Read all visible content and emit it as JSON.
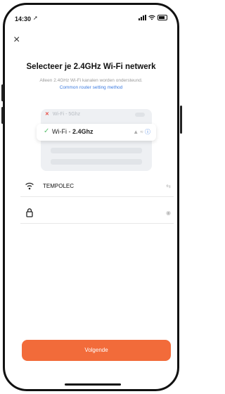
{
  "status": {
    "time": "14:30",
    "location_glyph": "➚"
  },
  "nav": {
    "close_glyph": "×"
  },
  "page": {
    "title": "Selecteer je 2.4GHz Wi-Fi netwerk",
    "subtitle": "Alleen 2.4GHz Wi-Fi kanalen worden ondersteund.",
    "link": "Common router setting method"
  },
  "illustration": {
    "row1_prefix": "Wi-Fi - ",
    "row1_band": "5Ghz",
    "row2_prefix": "Wi-Fi - ",
    "row2_band": "2.4Ghz"
  },
  "form": {
    "ssid_value": "TEMPOLEC",
    "password_value": ""
  },
  "actions": {
    "next_label": "Volgende"
  },
  "colors": {
    "accent": "#f26b3a",
    "link": "#3b7be0",
    "error": "#e84a42",
    "ok": "#5cbf6f"
  }
}
